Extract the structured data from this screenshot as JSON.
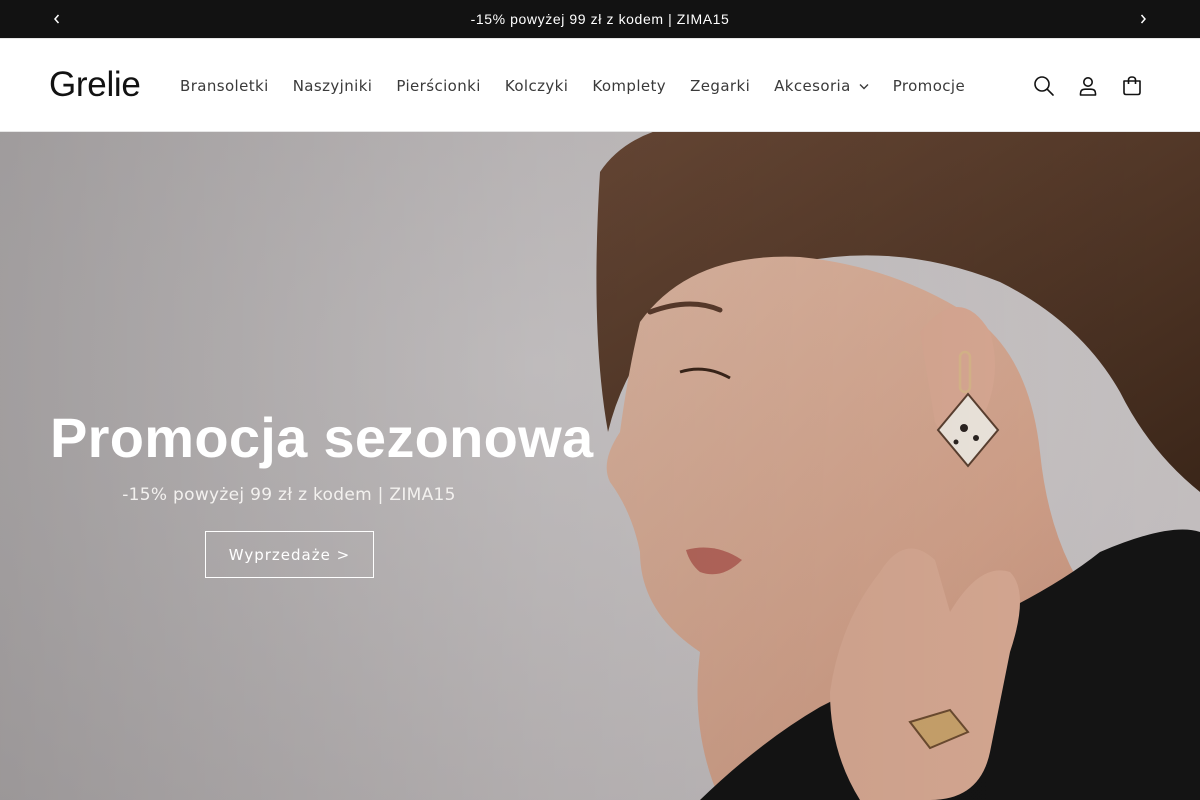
{
  "announcement": {
    "text": "-15% powyżej 99 zł z kodem | ZIMA15",
    "prev_icon": "chevron-left-icon",
    "next_icon": "chevron-right-icon"
  },
  "header": {
    "logo": "Grelie",
    "nav": [
      {
        "label": "Bransoletki"
      },
      {
        "label": "Naszyjniki"
      },
      {
        "label": "Pierścionki"
      },
      {
        "label": "Kolczyki"
      },
      {
        "label": "Komplety"
      },
      {
        "label": "Zegarki"
      },
      {
        "label": "Akcesoria",
        "has_dropdown": true
      },
      {
        "label": "Promocje"
      }
    ],
    "icons": [
      "search-icon",
      "account-icon",
      "cart-icon"
    ]
  },
  "hero": {
    "title": "Promocja sezonowa",
    "subtitle": "-15% powyżej 99 zł z kodem | ZIMA15",
    "button_label": "Wyprzedaże >"
  },
  "colors": {
    "announcement_bg": "#121212",
    "header_bg": "#ffffff",
    "text_dark": "#121212",
    "hero_text": "#ffffff",
    "hero_bg": "#c7c3c4",
    "jacket": "#141414"
  }
}
